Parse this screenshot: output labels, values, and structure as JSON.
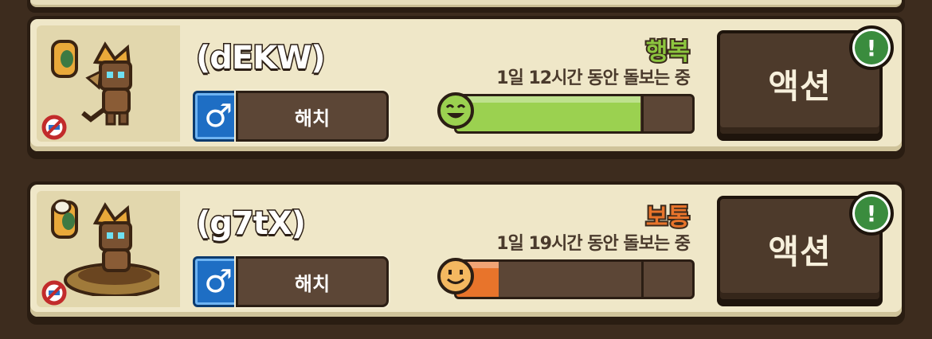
{
  "colors": {
    "happy_label": "#8dc63f",
    "normal_label": "#e8742b",
    "happy_bar": "#9bd150",
    "normal_bar": "#e8742b"
  },
  "pets": [
    {
      "name": "(dEKW)",
      "gender_symbol": "♂",
      "stage": "해치",
      "mood": "행복",
      "care_time": "1일 12시간 동안 돌보는 중",
      "mood_level": 0.78,
      "face": "happy-face-icon",
      "action_label": "액션",
      "alert": "!"
    },
    {
      "name": "(g7tX)",
      "gender_symbol": "♂",
      "stage": "해치",
      "mood": "보통",
      "care_time": "1일 19시간 동안 돌보는 중",
      "mood_level": 0.18,
      "face": "neutral-face-icon",
      "action_label": "액션",
      "alert": "!"
    }
  ]
}
